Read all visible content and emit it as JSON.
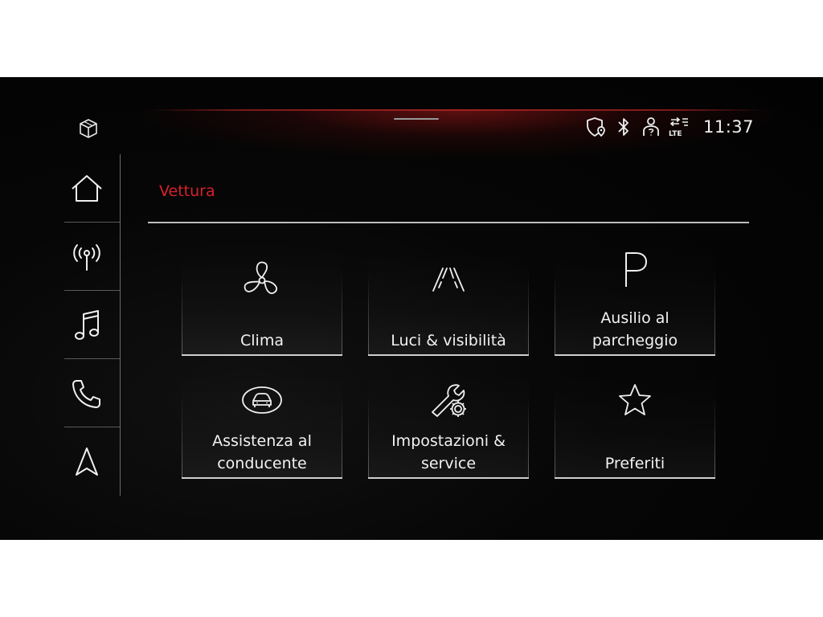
{
  "header": {
    "title": "Vettura",
    "clock": "11:37"
  },
  "colors": {
    "accent": "#d6222a",
    "background": "#050505",
    "text": "#f2f2f2"
  },
  "status_icons": [
    "shield-location-icon",
    "bluetooth-icon",
    "user-help-icon",
    "lte-signal-icon"
  ],
  "status": {
    "lte_label": "LTE"
  },
  "sidebar": {
    "top_icon": "cube-icon",
    "items": [
      {
        "id": "home",
        "icon": "home-icon"
      },
      {
        "id": "radio",
        "icon": "radio-icon"
      },
      {
        "id": "media",
        "icon": "music-icon"
      },
      {
        "id": "phone",
        "icon": "phone-icon"
      },
      {
        "id": "navigation",
        "icon": "navigation-icon"
      }
    ]
  },
  "tiles": [
    {
      "label": "Clima",
      "icon": "fan-icon"
    },
    {
      "label": "Luci & visibilità",
      "icon": "road-lights-icon"
    },
    {
      "label": "Ausilio al\nparcheggio",
      "icon": "parking-icon"
    },
    {
      "label": "Assistenza al\nconducente",
      "icon": "car-assist-icon"
    },
    {
      "label": "Impostazioni &\nservice",
      "icon": "wrench-gear-icon"
    },
    {
      "label": "Preferiti",
      "icon": "star-icon"
    }
  ]
}
